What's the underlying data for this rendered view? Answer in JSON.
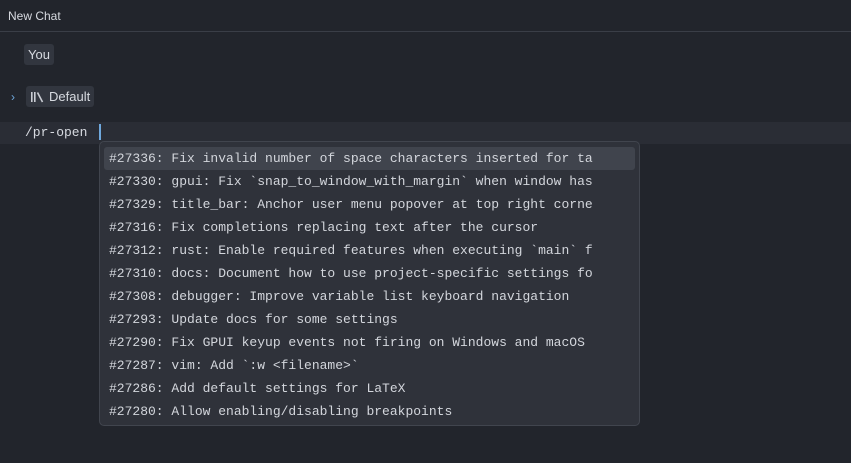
{
  "window": {
    "title": "New Chat"
  },
  "message": {
    "author": "You"
  },
  "profile": {
    "name": "Default",
    "icon": "library-icon"
  },
  "composer": {
    "value": "/pr-open"
  },
  "completions": {
    "selected_index": 0,
    "items": [
      "#27336: Fix invalid number of space characters inserted for ta",
      "#27330: gpui: Fix `snap_to_window_with_margin` when window has",
      "#27329: title_bar: Anchor user menu popover at top right corne",
      "#27316: Fix completions replacing text after the cursor",
      "#27312: rust: Enable required features when executing `main` f",
      "#27310: docs: Document how to use project-specific settings fo",
      "#27308: debugger: Improve variable list keyboard navigation",
      "#27293: Update docs for some settings",
      "#27290: Fix GPUI keyup events not firing on Windows and macOS",
      "#27287: vim: Add `:w <filename>`",
      "#27286: Add default settings for LaTeX",
      "#27280: Allow enabling/disabling breakpoints"
    ]
  }
}
